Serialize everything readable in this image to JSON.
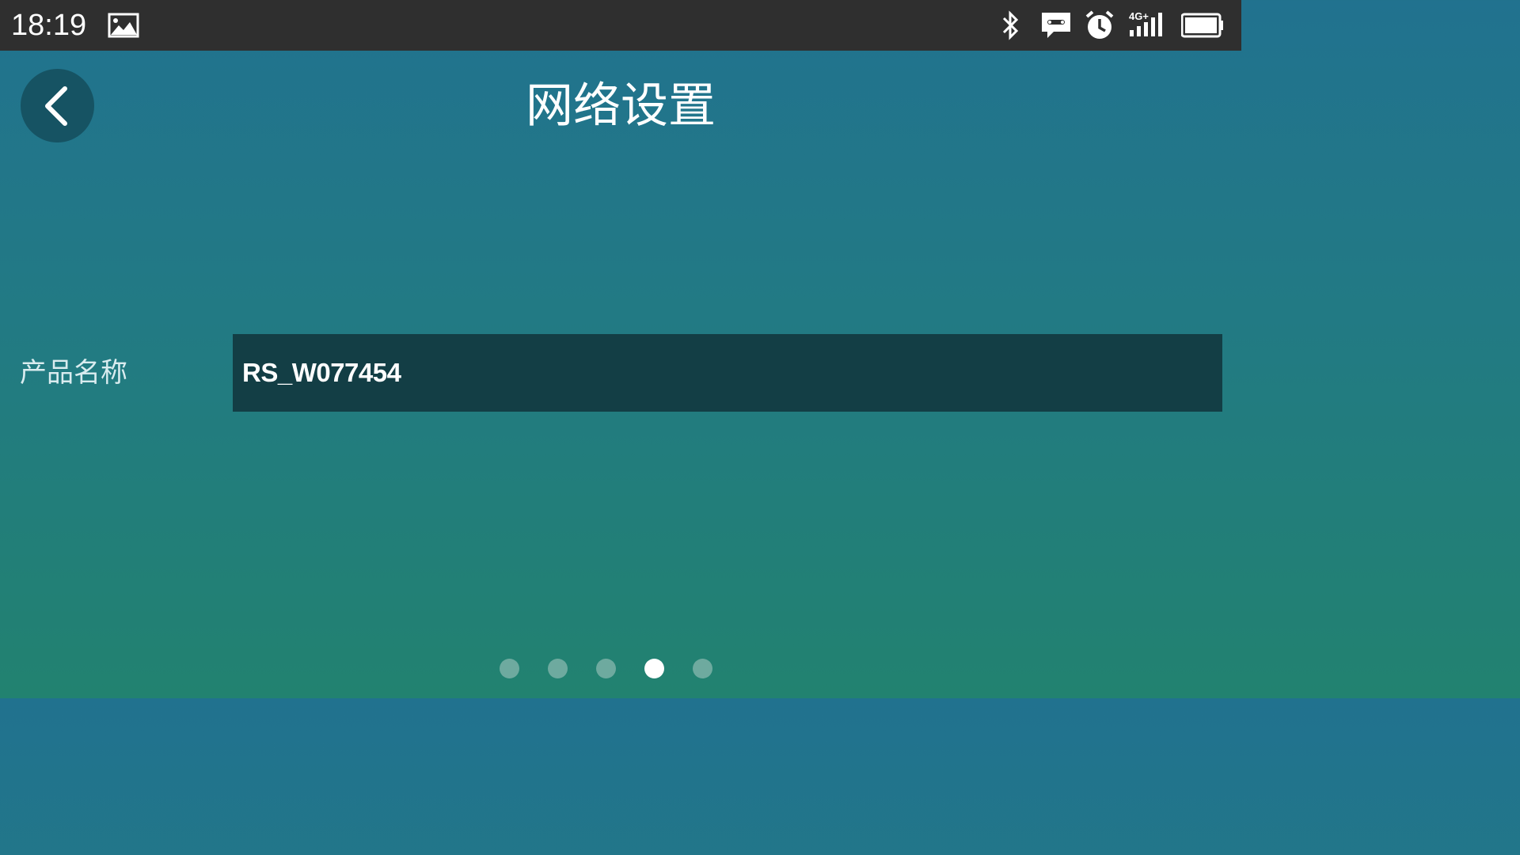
{
  "status_bar": {
    "time": "18:19",
    "icons": [
      "image-icon",
      "bluetooth-icon",
      "message-icon",
      "alarm-icon",
      "4g-signal-icon",
      "battery-icon"
    ],
    "network_label": "4G+"
  },
  "header": {
    "title": "网络设置",
    "back_icon": "chevron-left-icon"
  },
  "form": {
    "product_name_label": "产品名称",
    "product_name_value": "RS_W077454"
  },
  "pager": {
    "page_count": 5,
    "active_page": 4
  },
  "colors": {
    "status_bar": "#2f2f2f",
    "gradient_top": "#21728f",
    "gradient_bottom": "#228270",
    "input_background": "#133e45",
    "back_button": "#165363",
    "dot_inactive": "#6eaa9f",
    "dot_active": "#ffffff"
  }
}
